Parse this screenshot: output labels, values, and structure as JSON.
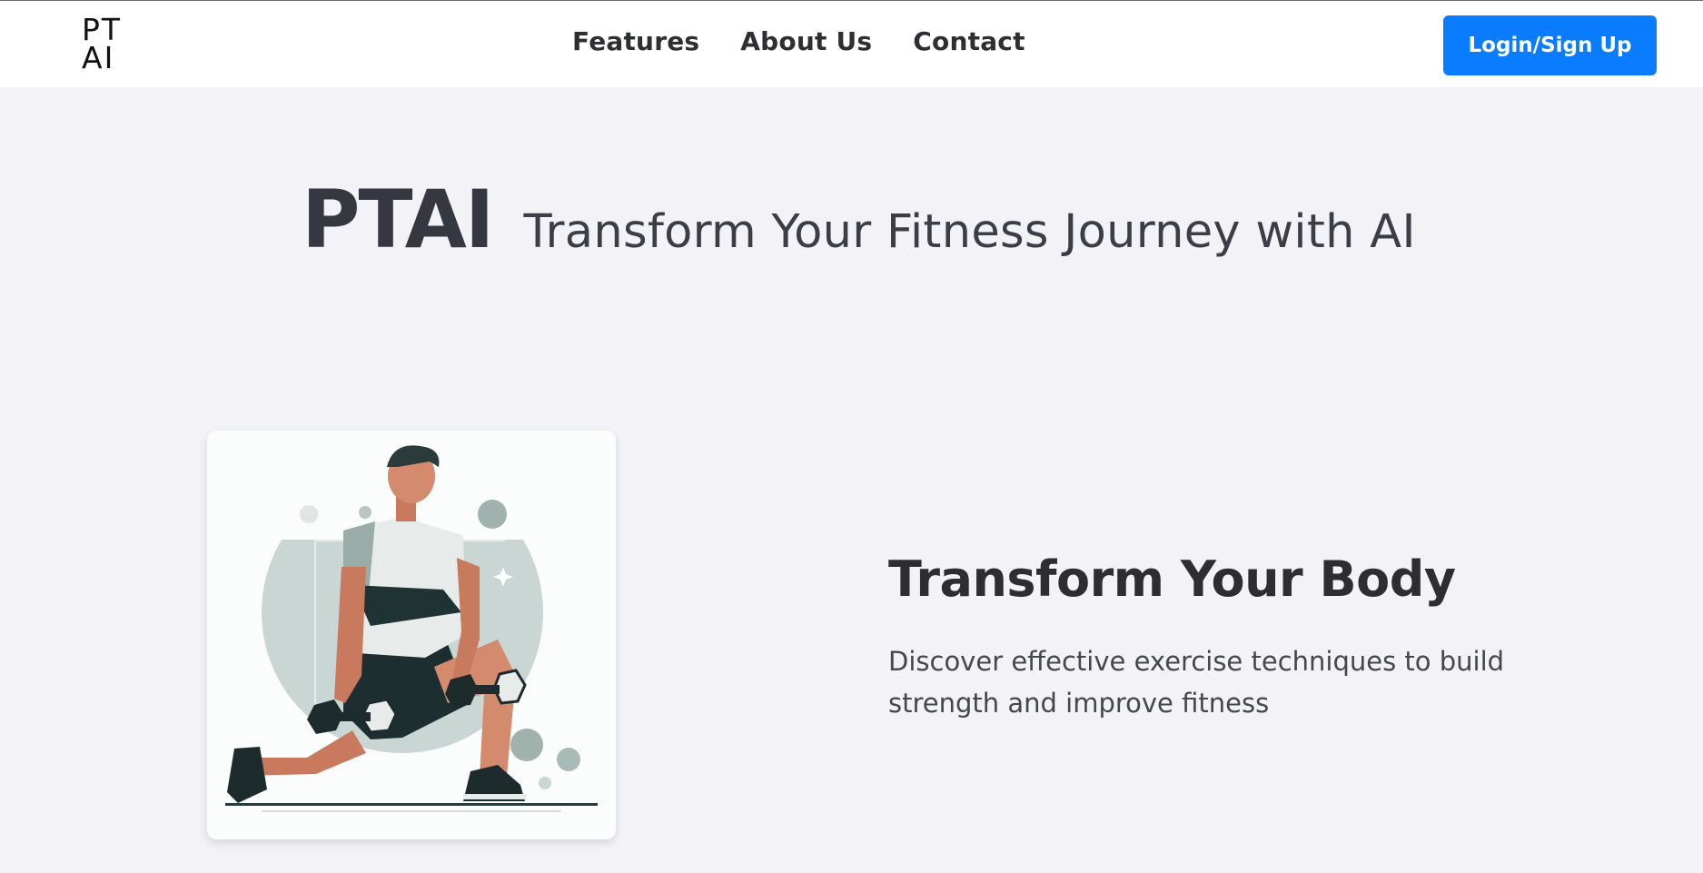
{
  "header": {
    "logo_line1": "PT",
    "logo_line2": "AI",
    "nav": [
      "Features",
      "About Us",
      "Contact"
    ],
    "login_label": "Login/Sign Up"
  },
  "hero": {
    "brand": "PTAI",
    "tagline": "Transform Your Fitness Journey with AI"
  },
  "feature": {
    "image_subject": "man-lunging-with-dumbbells-illustration",
    "title": "Transform Your Body",
    "description": "Discover effective exercise techniques to build strength and improve fitness"
  },
  "colors": {
    "accent": "#0a7cff",
    "background": "#f3f3f7",
    "header_bg": "#ffffff",
    "text": "#2f3035"
  }
}
